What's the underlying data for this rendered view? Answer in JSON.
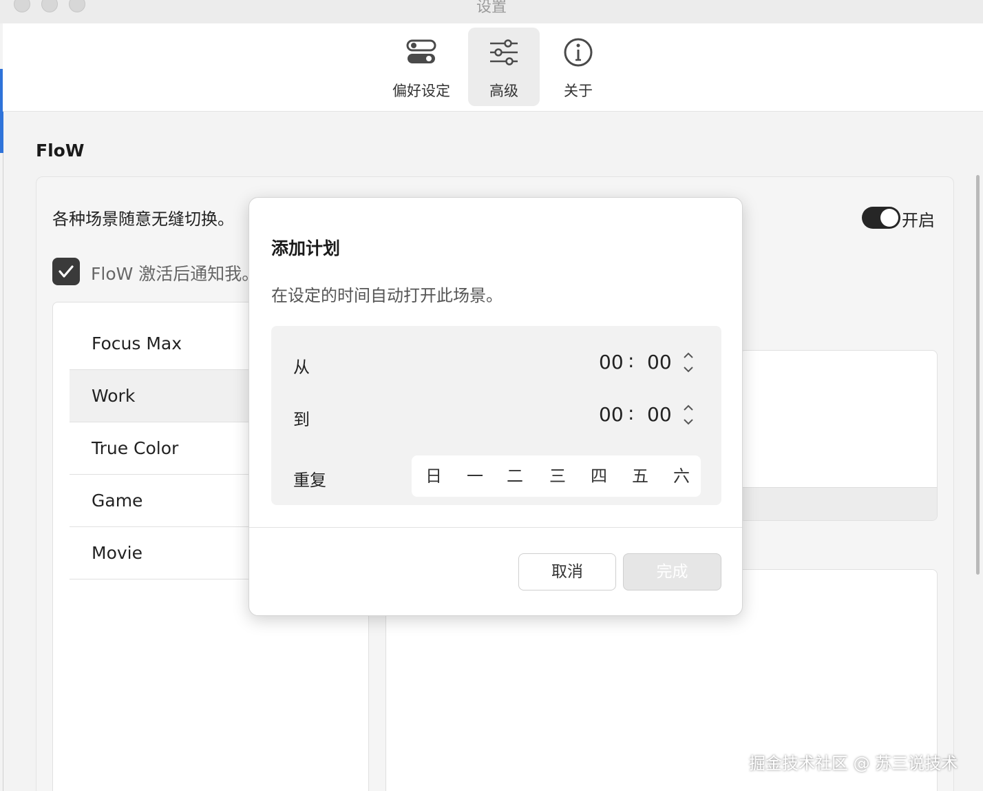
{
  "window": {
    "title": "设置"
  },
  "toolbar": {
    "items": [
      {
        "label": "偏好设定",
        "icon": "toggles-icon",
        "active": false
      },
      {
        "label": "高级",
        "icon": "sliders-icon",
        "active": true
      },
      {
        "label": "关于",
        "icon": "info-icon",
        "active": false
      }
    ]
  },
  "section": {
    "title": "FloW"
  },
  "panel": {
    "description": "各种场景随意无缝切换。",
    "toggle_label": "开启",
    "toggle_on": true,
    "notify_label": "FloW 激活后通知我。",
    "notify_checked": true
  },
  "scenes": {
    "items": [
      "Focus Max",
      "Work",
      "True Color",
      "Game",
      "Movie"
    ],
    "selected": "Work"
  },
  "dialog": {
    "title": "添加计划",
    "description": "在设定的时间自动打开此场景。",
    "from_label": "从",
    "from_hour": "00",
    "from_minute": "00",
    "to_label": "到",
    "to_hour": "00",
    "to_minute": "00",
    "time_separator": ":",
    "repeat_label": "重复",
    "days": [
      "日",
      "一",
      "二",
      "三",
      "四",
      "五",
      "六"
    ],
    "cancel_label": "取消",
    "done_label": "完成"
  },
  "watermark": "掘金技术社区 @ 苏三说技术",
  "colors": {
    "accent": "#2f73d9",
    "toggle_on": "#262626",
    "checkbox": "#3a3a3a"
  }
}
